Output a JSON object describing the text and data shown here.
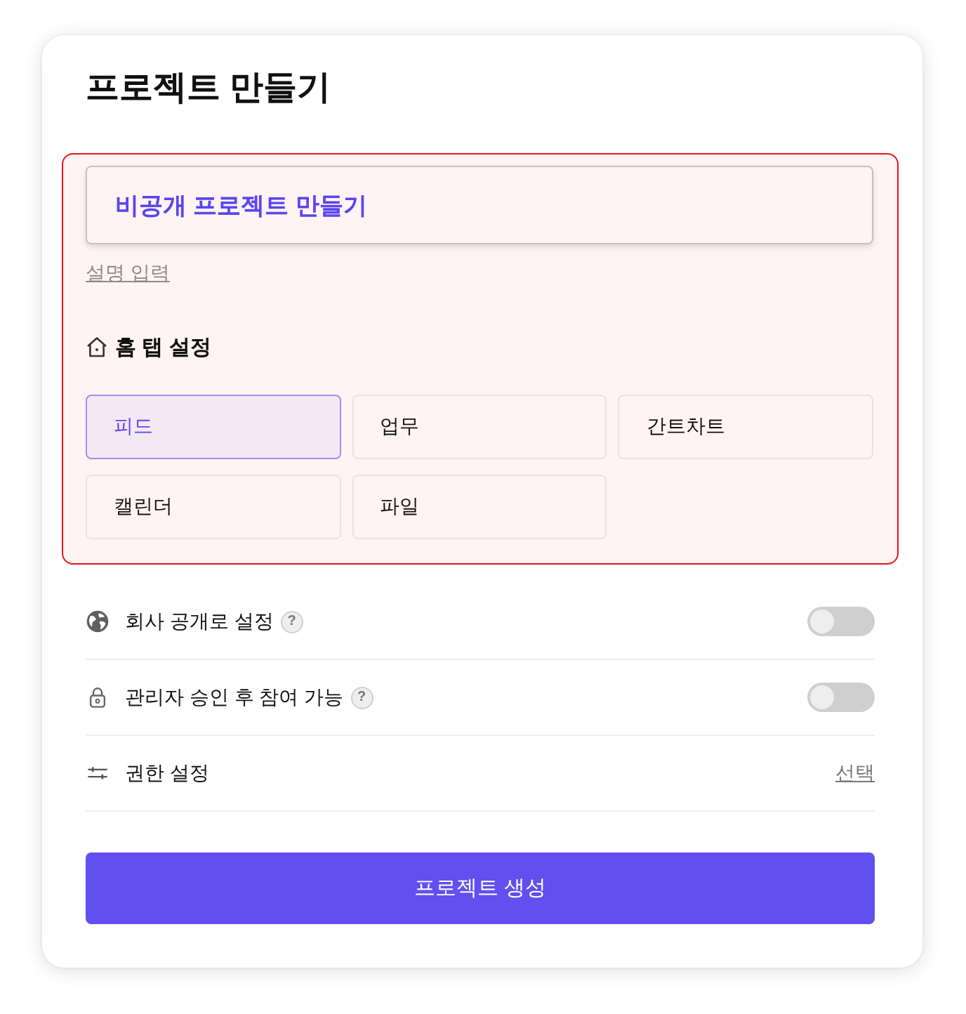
{
  "dialog": {
    "title": "프로젝트 만들기"
  },
  "details": {
    "highlighted": true,
    "name_field": {
      "value": "비공개 프로젝트 만들기"
    },
    "description_link": "설명 입력"
  },
  "home_tab": {
    "label": "홈 탭 설정",
    "options": [
      {
        "label": "피드",
        "selected": true
      },
      {
        "label": "업무",
        "selected": false
      },
      {
        "label": "간트차트",
        "selected": false
      },
      {
        "label": "캘린더",
        "selected": false
      },
      {
        "label": "파일",
        "selected": false
      }
    ]
  },
  "settings": [
    {
      "kind": "toggle",
      "label": "회사 공개로 설정",
      "help": "?",
      "on": false
    },
    {
      "kind": "toggle",
      "label": "관리자 승인 후 참여 가능",
      "help": "?",
      "on": false
    },
    {
      "kind": "select",
      "label": "권한 설정",
      "action": "선택"
    }
  ],
  "submit_button": "프로젝트 생성"
}
